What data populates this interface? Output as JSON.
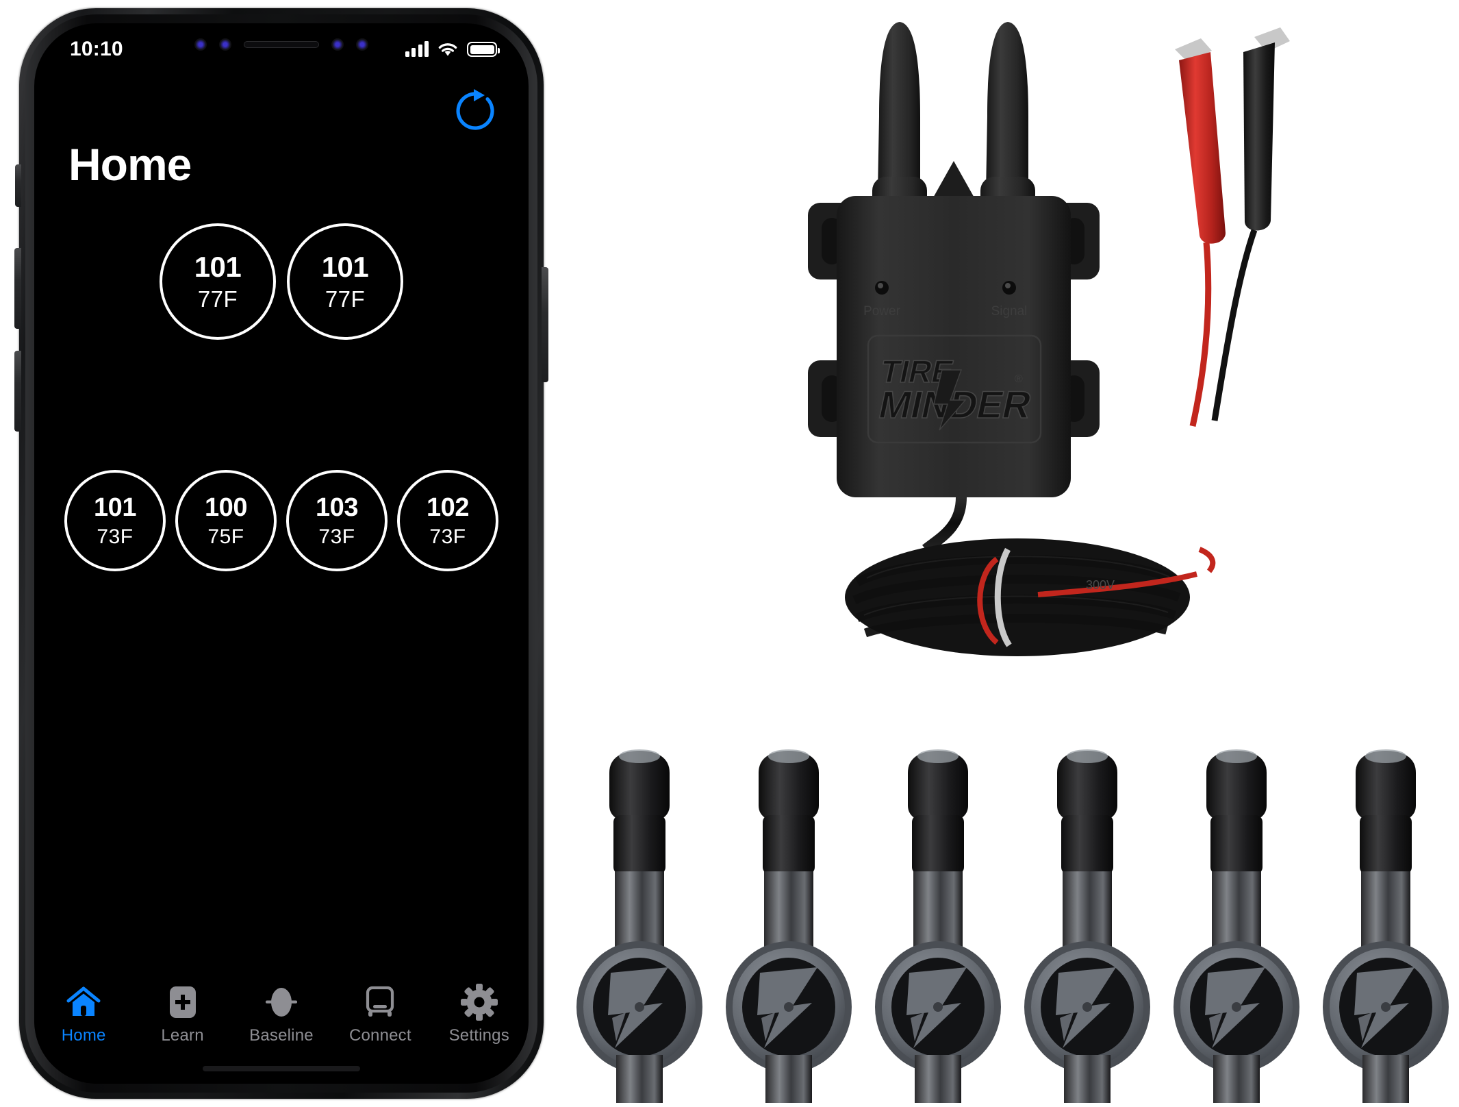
{
  "phone": {
    "status_bar": {
      "time": "10:10",
      "cellular_icon": "cellular-signal-icon",
      "wifi_icon": "wifi-icon",
      "battery_icon": "battery-full-icon"
    },
    "header": {
      "title": "Home",
      "refresh_icon": "refresh-circular-arrow-icon",
      "refresh_color": "#0a84ff"
    },
    "front_axle": [
      {
        "position": "front-left",
        "pressure": "101",
        "temperature": "77F"
      },
      {
        "position": "front-right",
        "pressure": "101",
        "temperature": "77F"
      }
    ],
    "rear_axle": [
      {
        "position": "rear-1",
        "pressure": "101",
        "temperature": "73F"
      },
      {
        "position": "rear-2",
        "pressure": "100",
        "temperature": "75F"
      },
      {
        "position": "rear-3",
        "pressure": "103",
        "temperature": "73F"
      },
      {
        "position": "rear-4",
        "pressure": "102",
        "temperature": "73F"
      }
    ],
    "tab_bar": {
      "active_color": "#0a84ff",
      "inactive_color": "#8e8e93",
      "tabs": [
        {
          "label": "Home",
          "icon": "house-icon",
          "active": true
        },
        {
          "label": "Learn",
          "icon": "plus-square-icon",
          "active": false
        },
        {
          "label": "Baseline",
          "icon": "tire-ellipse-icon",
          "active": false
        },
        {
          "label": "Connect",
          "icon": "bus-icon",
          "active": false
        },
        {
          "label": "Settings",
          "icon": "gear-icon",
          "active": false
        }
      ]
    }
  },
  "monitor": {
    "brand_line_1": "TIRE",
    "brand_line_2": "MINDER",
    "registered_mark": "®",
    "led_labels": {
      "power": "Power",
      "signal": "Signal"
    },
    "cable_marking": "300V",
    "clip_positive_color": "#d42a26",
    "clip_negative_color": "#141414"
  },
  "sensors": {
    "count": 6,
    "logo": "TM",
    "cap_color": "#1b1b1d",
    "face_color": "#6b7077"
  }
}
